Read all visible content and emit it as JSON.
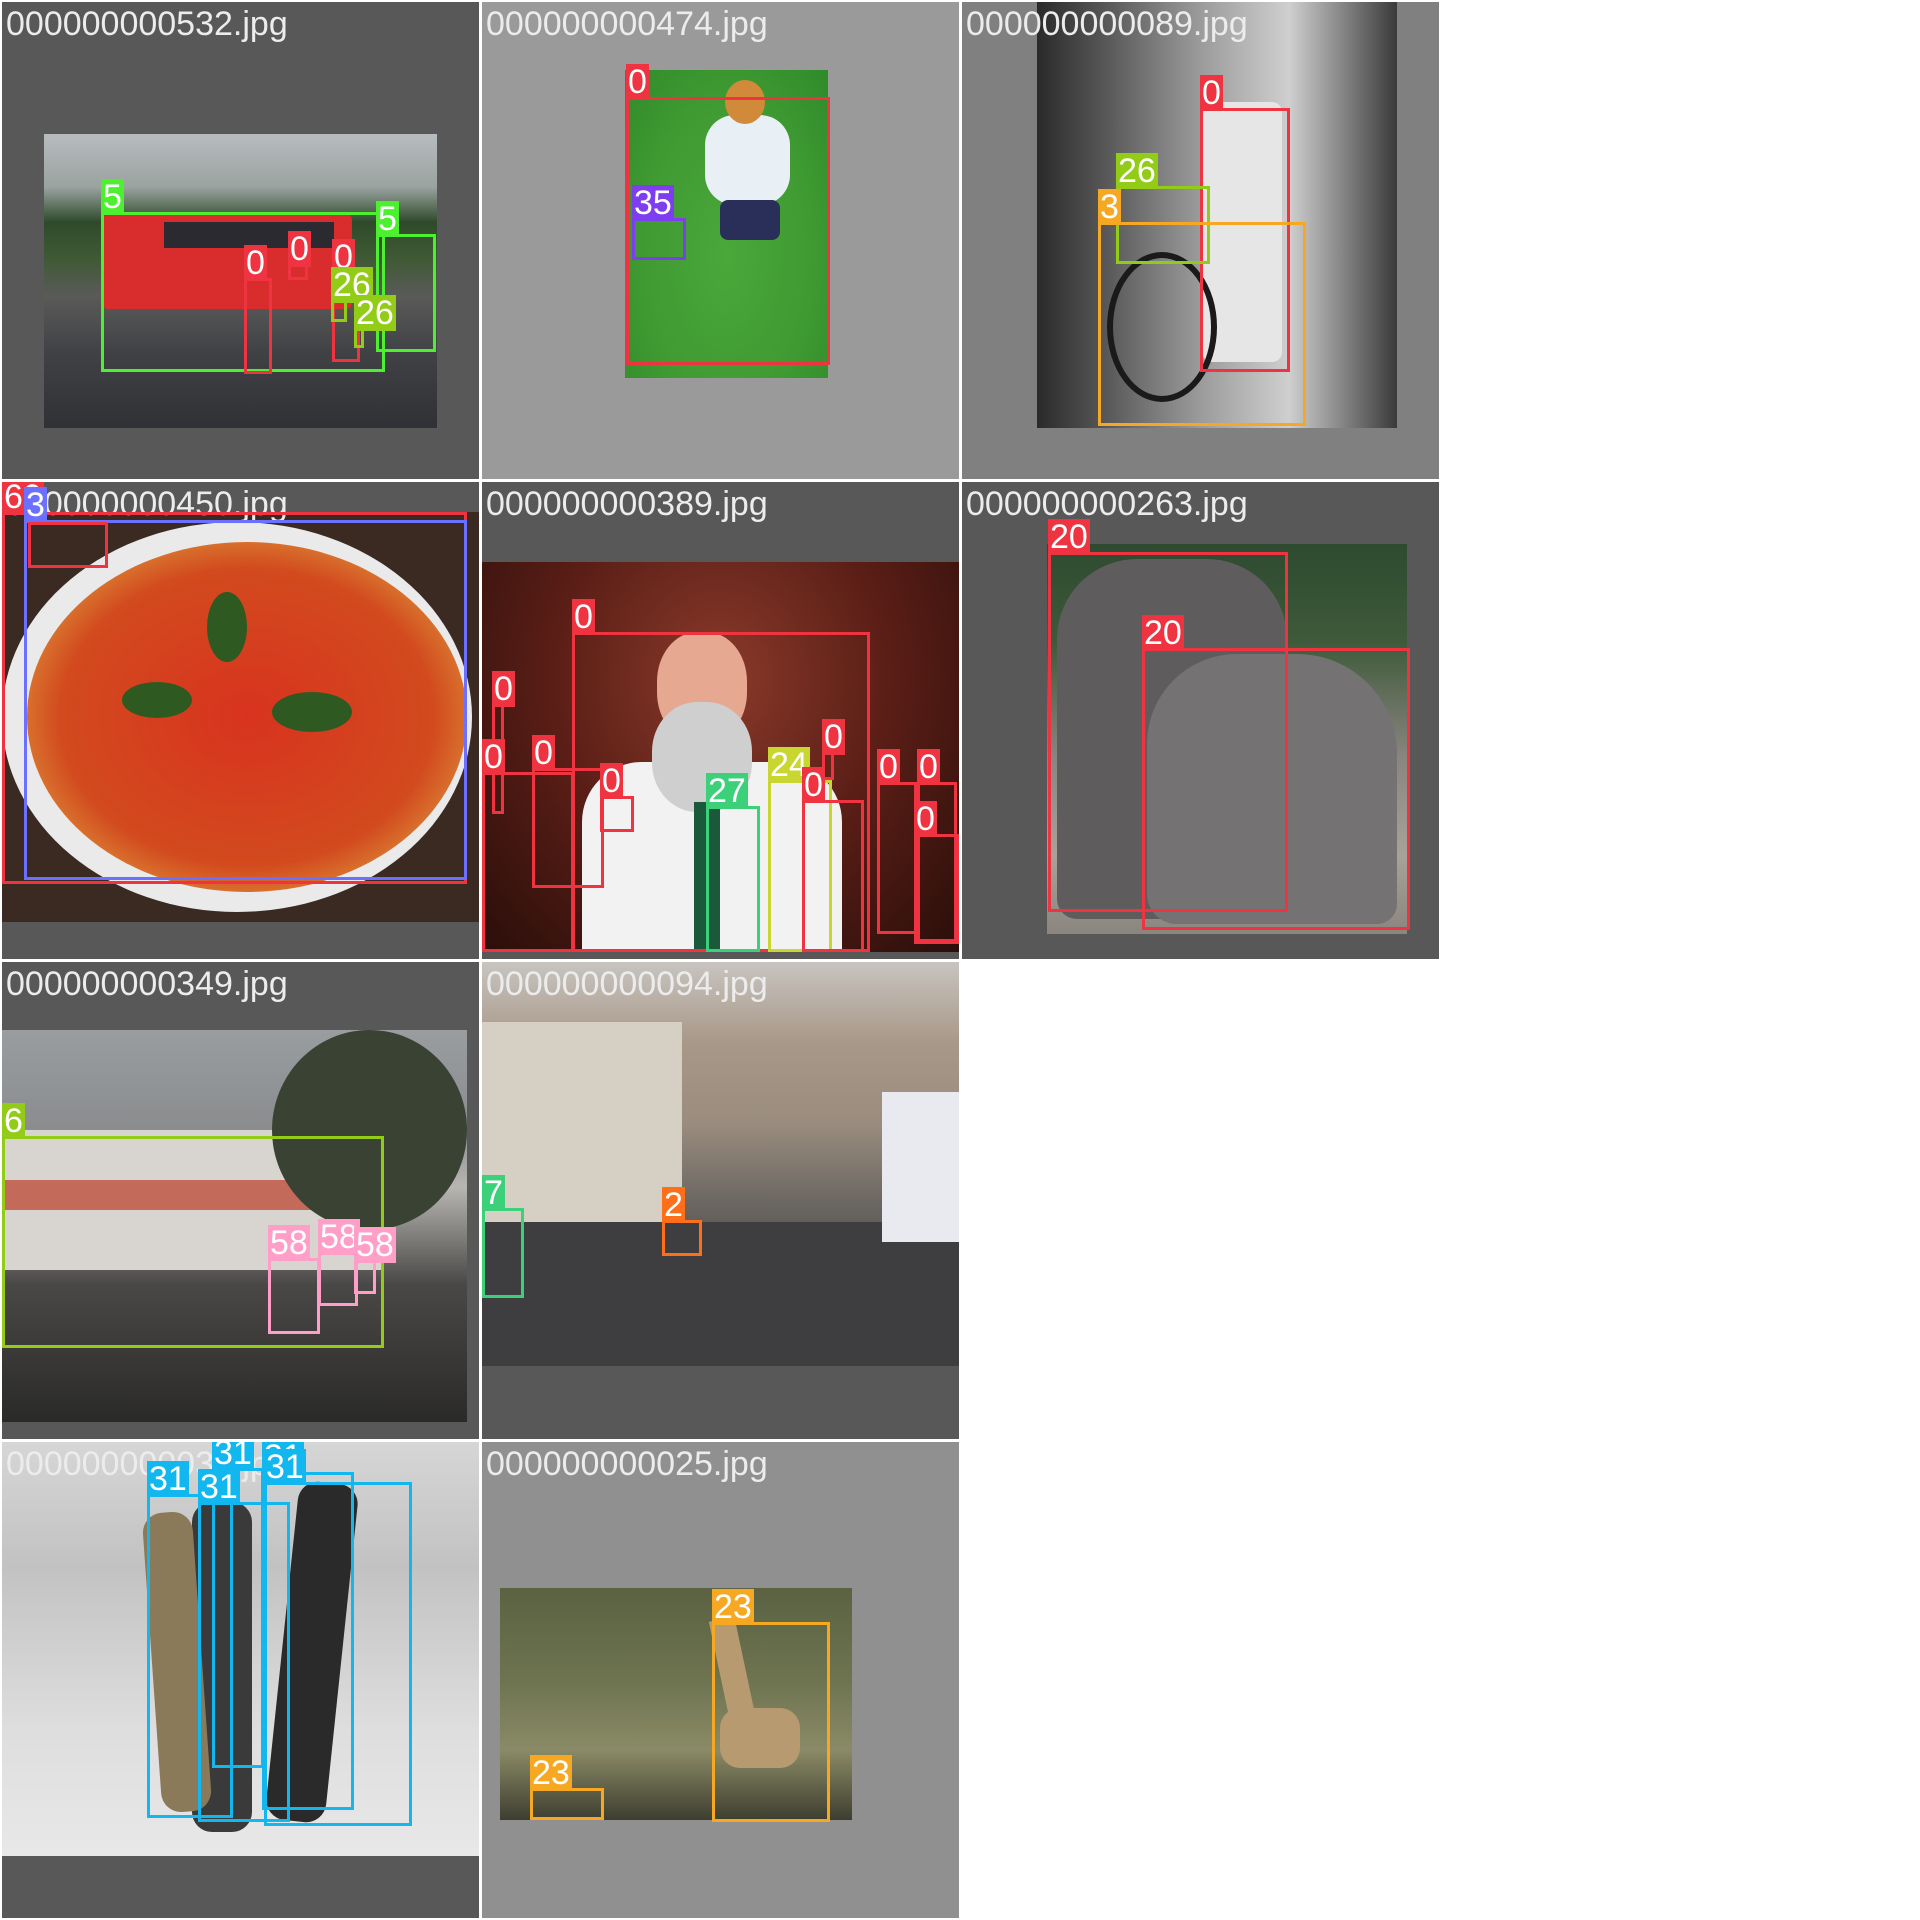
{
  "colors": {
    "c0": "#ef3340",
    "c2": "#ff6f1a",
    "c3": "#f7a823",
    "c5": "#4cf02e",
    "c6": "#92cc17",
    "c7": "#3dd07a",
    "c20": "#ef3340",
    "c23": "#f7a823",
    "c24": "#c9d630",
    "c26": "#92cc17",
    "c27": "#3dd07a",
    "c31": "#12b7ef",
    "c35": "#7e3ef0",
    "c58": "#ff9ec6",
    "c60": "#ef3340",
    "c_blue": "#6b70ff"
  },
  "tiles": [
    {
      "filename": "000000000532.jpg",
      "labels": [
        "5",
        "5",
        "0",
        "0",
        "0",
        "26",
        "26"
      ]
    },
    {
      "filename": "000000000474.jpg",
      "labels": [
        "0",
        "35"
      ]
    },
    {
      "filename": "000000000089.jpg",
      "labels": [
        "0",
        "26",
        "3"
      ]
    },
    {
      "filename": "000000000450.jpg",
      "labels": [
        "60",
        "3"
      ]
    },
    {
      "filename": "000000000389.jpg",
      "labels": [
        "0",
        "0",
        "0",
        "0",
        "0",
        "27",
        "24",
        "0",
        "0",
        "0",
        "0",
        "0"
      ]
    },
    {
      "filename": "000000000263.jpg",
      "labels": [
        "20",
        "20"
      ]
    },
    {
      "filename": "000000000349.jpg",
      "labels": [
        "6",
        "58",
        "58",
        "58"
      ]
    },
    {
      "filename": "000000000094.jpg",
      "labels": [
        "7",
        "2"
      ]
    },
    {
      "filename": "000000000034.jpg",
      "labels": [
        "31",
        "31",
        "31",
        "31",
        "31"
      ]
    },
    {
      "filename": "000000000025.jpg",
      "labels": [
        "23",
        "23"
      ]
    }
  ]
}
